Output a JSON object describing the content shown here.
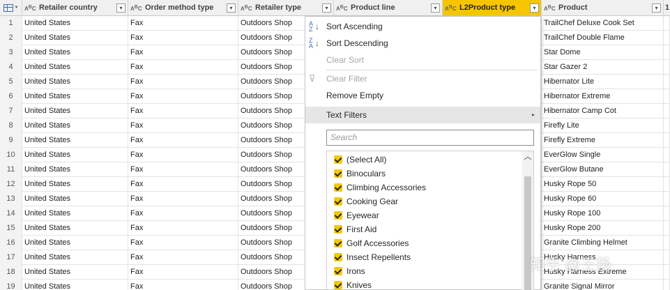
{
  "columns": [
    {
      "label": "Retailer country"
    },
    {
      "label": "Order method type"
    },
    {
      "label": "Retailer type"
    },
    {
      "label": "Product line"
    },
    {
      "label": "L2Product type"
    },
    {
      "label": "Product"
    },
    {
      "label": "1"
    }
  ],
  "type_glyph": "ABC",
  "rows": [
    {
      "n": "1",
      "country": "United States",
      "method": "Fax",
      "rtype": "Outdoors Shop",
      "product": "TrailChef Deluxe Cook Set"
    },
    {
      "n": "2",
      "country": "United States",
      "method": "Fax",
      "rtype": "Outdoors Shop",
      "product": "TrailChef Double Flame"
    },
    {
      "n": "3",
      "country": "United States",
      "method": "Fax",
      "rtype": "Outdoors Shop",
      "product": "Star Dome"
    },
    {
      "n": "4",
      "country": "United States",
      "method": "Fax",
      "rtype": "Outdoors Shop",
      "product": "Star Gazer 2"
    },
    {
      "n": "5",
      "country": "United States",
      "method": "Fax",
      "rtype": "Outdoors Shop",
      "product": "Hibernator Lite"
    },
    {
      "n": "6",
      "country": "United States",
      "method": "Fax",
      "rtype": "Outdoors Shop",
      "product": "Hibernator Extreme"
    },
    {
      "n": "7",
      "country": "United States",
      "method": "Fax",
      "rtype": "Outdoors Shop",
      "product": "Hibernator Camp Cot"
    },
    {
      "n": "8",
      "country": "United States",
      "method": "Fax",
      "rtype": "Outdoors Shop",
      "product": "Firefly Lite"
    },
    {
      "n": "9",
      "country": "United States",
      "method": "Fax",
      "rtype": "Outdoors Shop",
      "product": "Firefly Extreme"
    },
    {
      "n": "10",
      "country": "United States",
      "method": "Fax",
      "rtype": "Outdoors Shop",
      "product": "EverGlow Single"
    },
    {
      "n": "11",
      "country": "United States",
      "method": "Fax",
      "rtype": "Outdoors Shop",
      "product": "EverGlow Butane"
    },
    {
      "n": "12",
      "country": "United States",
      "method": "Fax",
      "rtype": "Outdoors Shop",
      "product": "Husky Rope 50"
    },
    {
      "n": "13",
      "country": "United States",
      "method": "Fax",
      "rtype": "Outdoors Shop",
      "product": "Husky Rope 60"
    },
    {
      "n": "14",
      "country": "United States",
      "method": "Fax",
      "rtype": "Outdoors Shop",
      "product": "Husky Rope 100"
    },
    {
      "n": "15",
      "country": "United States",
      "method": "Fax",
      "rtype": "Outdoors Shop",
      "product": "Husky Rope 200"
    },
    {
      "n": "16",
      "country": "United States",
      "method": "Fax",
      "rtype": "Outdoors Shop",
      "product": "Granite Climbing Helmet"
    },
    {
      "n": "17",
      "country": "United States",
      "method": "Fax",
      "rtype": "Outdoors Shop",
      "product": "Husky Harness"
    },
    {
      "n": "18",
      "country": "United States",
      "method": "Fax",
      "rtype": "Outdoors Shop",
      "product": "Husky Harness Extreme"
    },
    {
      "n": "19",
      "country": "United States",
      "method": "Fax",
      "rtype": "Outdoors Shop",
      "product": "Granite Signal Mirror"
    }
  ],
  "menu": {
    "sort_asc": "Sort Ascending",
    "sort_desc": "Sort Descending",
    "clear_sort": "Clear Sort",
    "clear_filter": "Clear Filter",
    "remove_empty": "Remove Empty",
    "text_filters": "Text Filters",
    "search_placeholder": "Search",
    "items": [
      "(Select All)",
      "Binoculars",
      "Climbing Accessories",
      "Cooking Gear",
      "Eyewear",
      "First Aid",
      "Golf Accessories",
      "Insect Repellents",
      "Irons",
      "Knives"
    ]
  },
  "watermark": "知乎 @王扬",
  "colors": {
    "selected_header": "#f6c500",
    "checkbox": "#f2c811"
  }
}
